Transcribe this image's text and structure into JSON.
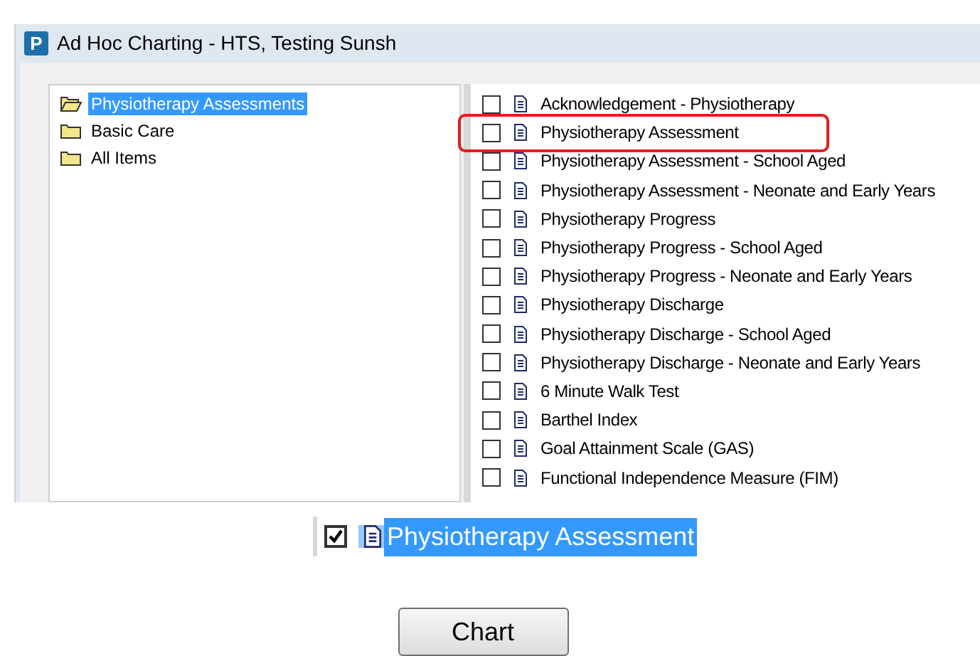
{
  "window": {
    "title": "Ad Hoc Charting - HTS, Testing Sunsh",
    "app_icon_letter": "P"
  },
  "tree": [
    {
      "label": "Physiotherapy Assessments",
      "selected": true
    },
    {
      "label": "Basic Care",
      "selected": false
    },
    {
      "label": "All Items",
      "selected": false
    }
  ],
  "forms": [
    {
      "label": "Acknowledgement - Physiotherapy",
      "checked": false,
      "highlighted": false
    },
    {
      "label": "Physiotherapy Assessment",
      "checked": false,
      "highlighted": true
    },
    {
      "label": "Physiotherapy Assessment - School Aged",
      "checked": false,
      "highlighted": false
    },
    {
      "label": "Physiotherapy Assessment - Neonate and Early Years",
      "checked": false,
      "highlighted": false
    },
    {
      "label": "Physiotherapy Progress",
      "checked": false,
      "highlighted": false
    },
    {
      "label": "Physiotherapy Progress - School Aged",
      "checked": false,
      "highlighted": false
    },
    {
      "label": "Physiotherapy Progress - Neonate and Early Years",
      "checked": false,
      "highlighted": false
    },
    {
      "label": "Physiotherapy Discharge",
      "checked": false,
      "highlighted": false
    },
    {
      "label": "Physiotherapy Discharge - School Aged",
      "checked": false,
      "highlighted": false
    },
    {
      "label": "Physiotherapy Discharge - Neonate and Early Years",
      "checked": false,
      "highlighted": false
    },
    {
      "label": "6 Minute Walk Test",
      "checked": false,
      "highlighted": false
    },
    {
      "label": "Barthel Index",
      "checked": false,
      "highlighted": false
    },
    {
      "label": "Goal Attainment Scale (GAS)",
      "checked": false,
      "highlighted": false
    },
    {
      "label": "Functional Independence Measure (FIM)",
      "checked": false,
      "highlighted": false
    }
  ],
  "zoomed_item": {
    "label": "Physiotherapy Assessment",
    "checked": true,
    "selected": true
  },
  "buttons": [
    "Chart"
  ]
}
